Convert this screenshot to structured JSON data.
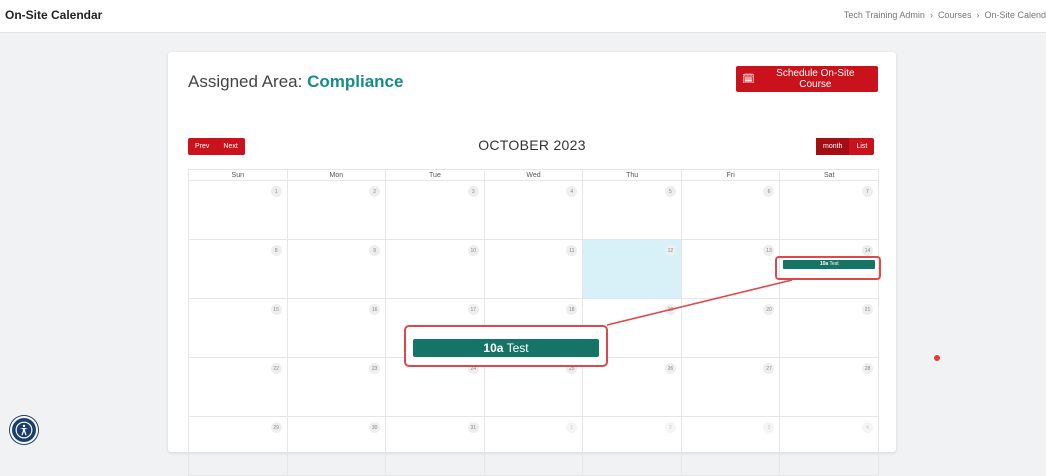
{
  "topbar": {
    "page_title": "On-Site Calendar",
    "breadcrumbs": [
      "Tech Training Admin",
      "Courses",
      "On-Site Calend"
    ],
    "separator": "›"
  },
  "header": {
    "prefix": "Assigned Area:",
    "area": "Compliance",
    "schedule_button": "Schedule On-Site Course"
  },
  "calendar": {
    "prev_label": "Prev",
    "next_label": "Next",
    "title": "OCTOBER 2023",
    "month_label": "month",
    "list_label": "List",
    "weekdays": [
      "Sun",
      "Mon",
      "Tue",
      "Wed",
      "Thu",
      "Fri",
      "Sat"
    ],
    "weeks": [
      [
        "1",
        "2",
        "3",
        "4",
        "5",
        "6",
        "7"
      ],
      [
        "8",
        "9",
        "10",
        "11",
        "12",
        "13",
        "14"
      ],
      [
        "15",
        "16",
        "17",
        "18",
        "19",
        "20",
        "21"
      ],
      [
        "22",
        "23",
        "24",
        "25",
        "26",
        "27",
        "28"
      ],
      [
        "29",
        "30",
        "31",
        "1",
        "2",
        "3",
        "4"
      ]
    ],
    "today": "12",
    "event": {
      "time": "10a",
      "title": "Test",
      "day": "14"
    }
  },
  "colors": {
    "brand_red": "#c9121b",
    "accent_teal": "#178a8a",
    "event_green": "#167466",
    "today_bg": "#d8f1f8",
    "annotation_red": "#e0474c"
  }
}
